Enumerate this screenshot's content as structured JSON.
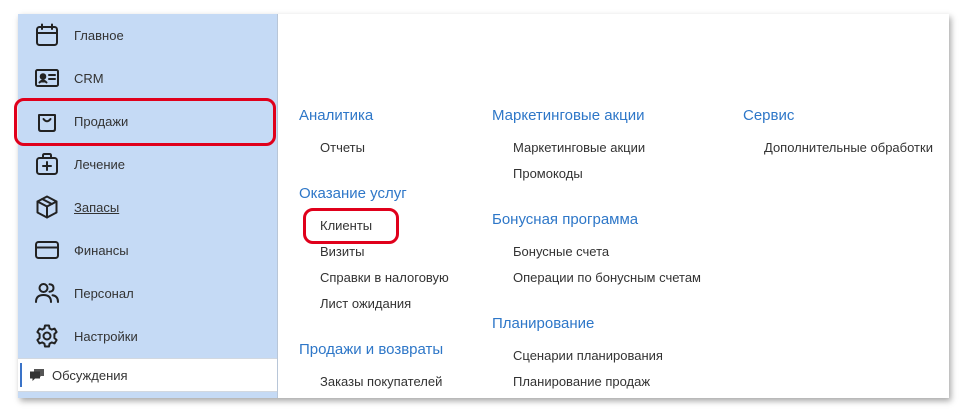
{
  "sidebar": {
    "items": [
      {
        "label": "Главное",
        "icon": "calendar-icon"
      },
      {
        "label": "CRM",
        "icon": "contact-card-icon"
      },
      {
        "label": "Продажи",
        "icon": "shopping-bag-icon"
      },
      {
        "label": "Лечение",
        "icon": "medical-kit-icon"
      },
      {
        "label": "Запасы",
        "icon": "box-icon"
      },
      {
        "label": "Финансы",
        "icon": "credit-card-icon"
      },
      {
        "label": "Персонал",
        "icon": "people-icon"
      },
      {
        "label": "Настройки",
        "icon": "gear-icon"
      }
    ],
    "discussions_label": "Обсуждения"
  },
  "content": {
    "col1": {
      "analytics": {
        "title": "Аналитика",
        "links": [
          "Отчеты"
        ]
      },
      "services": {
        "title": "Оказание услуг",
        "links": [
          "Клиенты",
          "Визиты",
          "Справки в налоговую",
          "Лист ожидания"
        ]
      },
      "sales_returns": {
        "title": "Продажи и возвраты",
        "links": [
          "Заказы покупателей"
        ]
      }
    },
    "col2": {
      "marketing": {
        "title": "Маркетинговые акции",
        "links": [
          "Маркетинговые акции",
          "Промокоды"
        ]
      },
      "bonus": {
        "title": "Бонусная программа",
        "links": [
          "Бонусные счета",
          "Операции по бонусным счетам"
        ]
      },
      "planning": {
        "title": "Планирование",
        "links": [
          "Сценарии планирования",
          "Планирование продаж"
        ]
      }
    },
    "col3": {
      "service": {
        "title": "Сервис",
        "links": [
          "Дополнительные обработки"
        ]
      }
    }
  },
  "colors": {
    "sidebar_bg": "#c5daf5",
    "group_title": "#2e77c8",
    "highlight": "#e0001b",
    "active_bar": "#3a73c8"
  }
}
